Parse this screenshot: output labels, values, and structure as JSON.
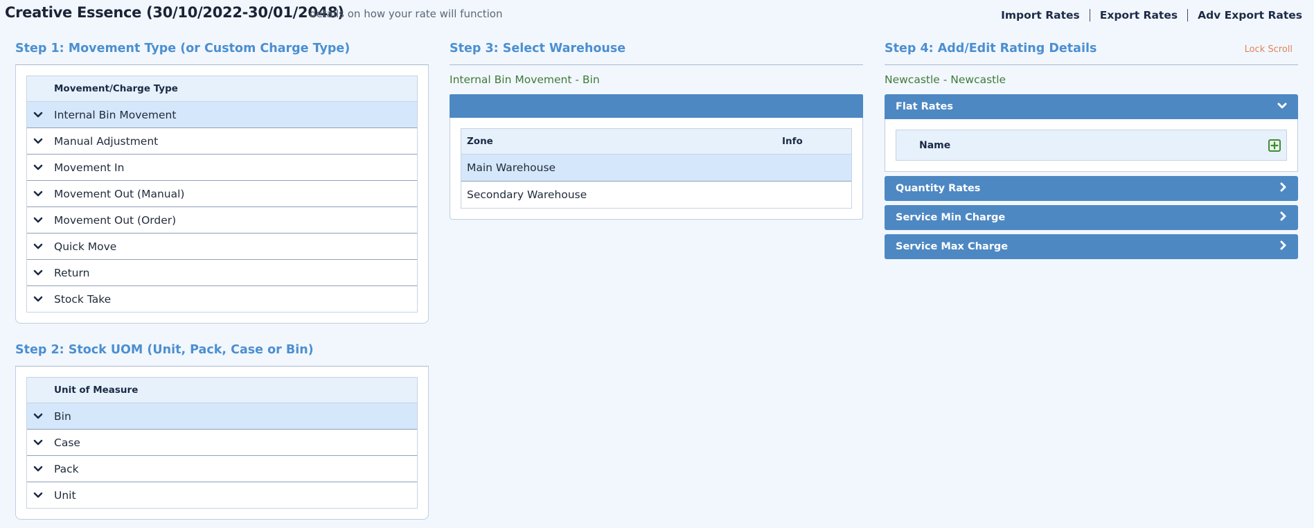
{
  "header": {
    "title": "Creative Essence (30/10/2022-30/01/2048)",
    "subtitle": "details on how your rate will function",
    "links": [
      "Import Rates",
      "Export Rates",
      "Adv Export Rates"
    ]
  },
  "step1": {
    "title": "Step 1: Movement Type (or Custom Charge Type)",
    "column": "Movement/Charge Type",
    "items": [
      "Internal Bin Movement",
      "Manual Adjustment",
      "Movement In",
      "Movement Out (Manual)",
      "Movement Out (Order)",
      "Quick Move",
      "Return",
      "Stock Take"
    ],
    "selected": "Internal Bin Movement"
  },
  "step2": {
    "title": "Step 2: Stock UOM (Unit, Pack, Case or Bin)",
    "column": "Unit of Measure",
    "items": [
      "Bin",
      "Case",
      "Pack",
      "Unit"
    ],
    "selected": "Bin"
  },
  "step3": {
    "title": "Step 3: Select Warehouse",
    "context": "Internal Bin Movement - Bin",
    "columns": {
      "zone": "Zone",
      "info": "Info"
    },
    "rows": [
      {
        "zone": "Main Warehouse",
        "info": ""
      },
      {
        "zone": "Secondary Warehouse",
        "info": ""
      }
    ],
    "selected": "Main Warehouse"
  },
  "step4": {
    "title": "Step 4: Add/Edit Rating Details",
    "lock_scroll": "Lock Scroll",
    "context": "Newcastle - Newcastle",
    "sections": [
      {
        "label": "Flat Rates",
        "open": true
      },
      {
        "label": "Quantity Rates",
        "open": false
      },
      {
        "label": "Service Min Charge",
        "open": false
      },
      {
        "label": "Service Max Charge",
        "open": false
      }
    ],
    "flat_rates_column": "Name"
  },
  "colors": {
    "accent_blue": "#4d88c3",
    "title_blue": "#4b8fd0",
    "selected_row": "#d5e7fa",
    "context_green": "#3f7a3a",
    "lock_scroll": "#e2825a"
  }
}
